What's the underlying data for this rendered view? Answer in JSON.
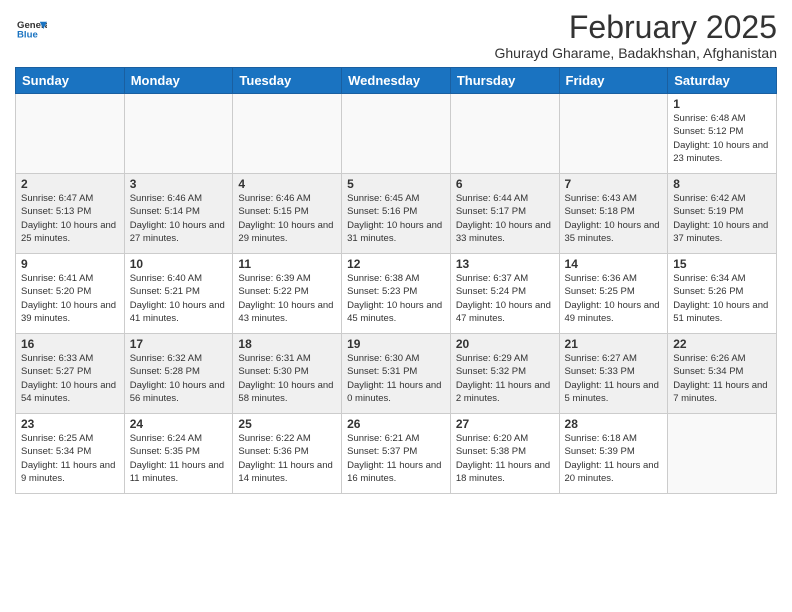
{
  "logo": {
    "line1": "General",
    "line2": "Blue"
  },
  "title": "February 2025",
  "subtitle": "Ghurayd Gharame, Badakhshan, Afghanistan",
  "headers": [
    "Sunday",
    "Monday",
    "Tuesday",
    "Wednesday",
    "Thursday",
    "Friday",
    "Saturday"
  ],
  "weeks": [
    [
      {
        "day": "",
        "info": ""
      },
      {
        "day": "",
        "info": ""
      },
      {
        "day": "",
        "info": ""
      },
      {
        "day": "",
        "info": ""
      },
      {
        "day": "",
        "info": ""
      },
      {
        "day": "",
        "info": ""
      },
      {
        "day": "1",
        "info": "Sunrise: 6:48 AM\nSunset: 5:12 PM\nDaylight: 10 hours and 23 minutes."
      }
    ],
    [
      {
        "day": "2",
        "info": "Sunrise: 6:47 AM\nSunset: 5:13 PM\nDaylight: 10 hours and 25 minutes."
      },
      {
        "day": "3",
        "info": "Sunrise: 6:46 AM\nSunset: 5:14 PM\nDaylight: 10 hours and 27 minutes."
      },
      {
        "day": "4",
        "info": "Sunrise: 6:46 AM\nSunset: 5:15 PM\nDaylight: 10 hours and 29 minutes."
      },
      {
        "day": "5",
        "info": "Sunrise: 6:45 AM\nSunset: 5:16 PM\nDaylight: 10 hours and 31 minutes."
      },
      {
        "day": "6",
        "info": "Sunrise: 6:44 AM\nSunset: 5:17 PM\nDaylight: 10 hours and 33 minutes."
      },
      {
        "day": "7",
        "info": "Sunrise: 6:43 AM\nSunset: 5:18 PM\nDaylight: 10 hours and 35 minutes."
      },
      {
        "day": "8",
        "info": "Sunrise: 6:42 AM\nSunset: 5:19 PM\nDaylight: 10 hours and 37 minutes."
      }
    ],
    [
      {
        "day": "9",
        "info": "Sunrise: 6:41 AM\nSunset: 5:20 PM\nDaylight: 10 hours and 39 minutes."
      },
      {
        "day": "10",
        "info": "Sunrise: 6:40 AM\nSunset: 5:21 PM\nDaylight: 10 hours and 41 minutes."
      },
      {
        "day": "11",
        "info": "Sunrise: 6:39 AM\nSunset: 5:22 PM\nDaylight: 10 hours and 43 minutes."
      },
      {
        "day": "12",
        "info": "Sunrise: 6:38 AM\nSunset: 5:23 PM\nDaylight: 10 hours and 45 minutes."
      },
      {
        "day": "13",
        "info": "Sunrise: 6:37 AM\nSunset: 5:24 PM\nDaylight: 10 hours and 47 minutes."
      },
      {
        "day": "14",
        "info": "Sunrise: 6:36 AM\nSunset: 5:25 PM\nDaylight: 10 hours and 49 minutes."
      },
      {
        "day": "15",
        "info": "Sunrise: 6:34 AM\nSunset: 5:26 PM\nDaylight: 10 hours and 51 minutes."
      }
    ],
    [
      {
        "day": "16",
        "info": "Sunrise: 6:33 AM\nSunset: 5:27 PM\nDaylight: 10 hours and 54 minutes."
      },
      {
        "day": "17",
        "info": "Sunrise: 6:32 AM\nSunset: 5:28 PM\nDaylight: 10 hours and 56 minutes."
      },
      {
        "day": "18",
        "info": "Sunrise: 6:31 AM\nSunset: 5:30 PM\nDaylight: 10 hours and 58 minutes."
      },
      {
        "day": "19",
        "info": "Sunrise: 6:30 AM\nSunset: 5:31 PM\nDaylight: 11 hours and 0 minutes."
      },
      {
        "day": "20",
        "info": "Sunrise: 6:29 AM\nSunset: 5:32 PM\nDaylight: 11 hours and 2 minutes."
      },
      {
        "day": "21",
        "info": "Sunrise: 6:27 AM\nSunset: 5:33 PM\nDaylight: 11 hours and 5 minutes."
      },
      {
        "day": "22",
        "info": "Sunrise: 6:26 AM\nSunset: 5:34 PM\nDaylight: 11 hours and 7 minutes."
      }
    ],
    [
      {
        "day": "23",
        "info": "Sunrise: 6:25 AM\nSunset: 5:34 PM\nDaylight: 11 hours and 9 minutes."
      },
      {
        "day": "24",
        "info": "Sunrise: 6:24 AM\nSunset: 5:35 PM\nDaylight: 11 hours and 11 minutes."
      },
      {
        "day": "25",
        "info": "Sunrise: 6:22 AM\nSunset: 5:36 PM\nDaylight: 11 hours and 14 minutes."
      },
      {
        "day": "26",
        "info": "Sunrise: 6:21 AM\nSunset: 5:37 PM\nDaylight: 11 hours and 16 minutes."
      },
      {
        "day": "27",
        "info": "Sunrise: 6:20 AM\nSunset: 5:38 PM\nDaylight: 11 hours and 18 minutes."
      },
      {
        "day": "28",
        "info": "Sunrise: 6:18 AM\nSunset: 5:39 PM\nDaylight: 11 hours and 20 minutes."
      },
      {
        "day": "",
        "info": ""
      }
    ]
  ]
}
